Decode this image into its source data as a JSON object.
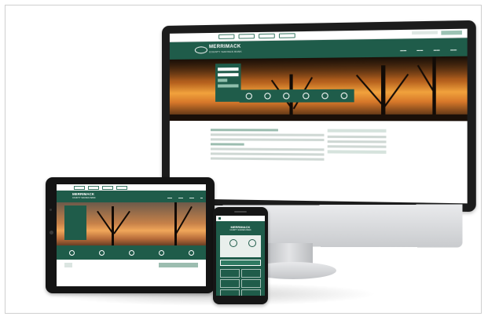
{
  "scene": {
    "description_devices": [
      "desktop-monitor",
      "tablet",
      "smartphone"
    ]
  },
  "site": {
    "brand_line1": "MERRIMACK",
    "brand_line2": "COUNTY SAVINGS BANK"
  },
  "colors": {
    "brand_green": "#1f5c4a",
    "accent_green": "#9cbdb0",
    "hero_orange": "#f1a23c",
    "device_black": "#1c1c1c",
    "monitor_silver": "#d6d8db"
  }
}
